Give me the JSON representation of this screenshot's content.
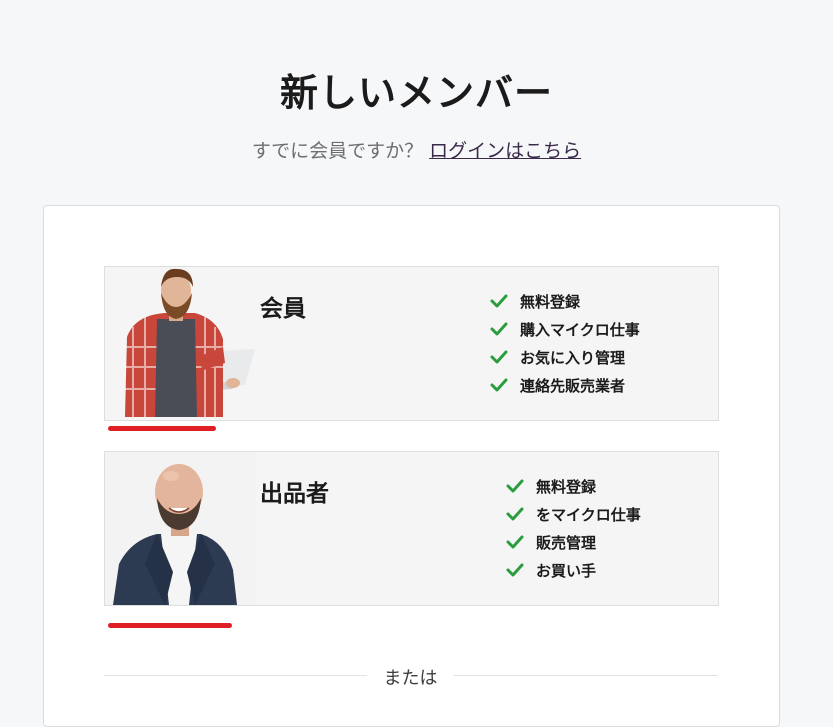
{
  "header": {
    "title": "新しいメンバー",
    "subtitle_text": "すでに会員ですか？",
    "login_link": "ログインはこちら"
  },
  "options": [
    {
      "title": "会員",
      "features": [
        "無料登録",
        "購入マイクロ仕事",
        "お気に入り管理",
        "連絡先販売業者"
      ]
    },
    {
      "title": "出品者",
      "features": [
        "無料登録",
        "をマイクロ仕事",
        "販売管理",
        "お買い手"
      ]
    }
  ],
  "divider": {
    "text": "または"
  },
  "colors": {
    "accent_red": "#e01e26",
    "check_green": "#2a9d3f",
    "background": "#f6f7f9"
  },
  "icons": {
    "feature_check": "check-icon"
  }
}
